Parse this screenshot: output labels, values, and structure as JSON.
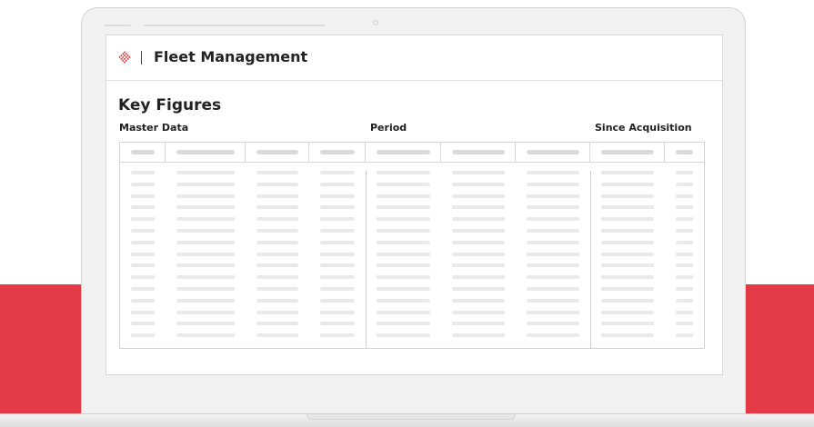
{
  "colors": {
    "accent": "#e23a46",
    "placeholder": "#e9e9e9"
  },
  "header": {
    "logo_icon": "diamond-dot-logo-icon",
    "app_title": "Fleet Management"
  },
  "page": {
    "title": "Key Figures",
    "groups": {
      "master": "Master Data",
      "period": "Period",
      "since": "Since Acquisition"
    }
  },
  "table": {
    "column_count": 9,
    "row_count": 15
  }
}
